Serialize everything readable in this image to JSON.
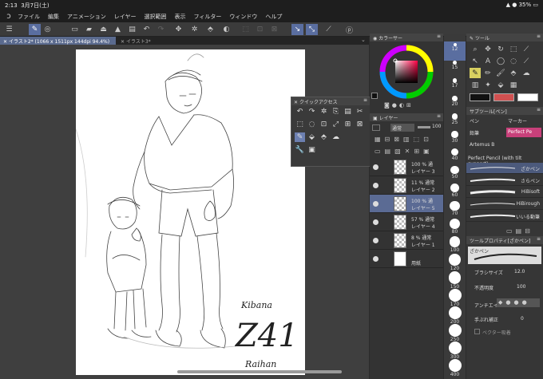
{
  "status": {
    "time": "2:13",
    "date": "3月7日(土)",
    "battery": "35%"
  },
  "menu": [
    "ファイル",
    "編集",
    "アニメーション",
    "レイヤー",
    "選択範囲",
    "表示",
    "フィルター",
    "ウィンドウ",
    "ヘルプ"
  ],
  "tabs": [
    {
      "label": "イラスト2* (1066 x 1511px 144dpi 94.4%)",
      "active": true
    },
    {
      "label": "イラスト3*",
      "active": false
    }
  ],
  "signature": {
    "line1": "Kibana",
    "line2": "Z41",
    "line3": "Raihan"
  },
  "color_panel": {
    "title": "カラーサー"
  },
  "layer_panel": {
    "title": "レイヤー",
    "blend": "通常",
    "opacity": "100"
  },
  "layers": [
    {
      "line1": "100 % 通",
      "line2": "レイヤー 3",
      "selected": false,
      "thumb": "chk"
    },
    {
      "line1": "11 % 通常",
      "line2": "レイヤー 2",
      "selected": false,
      "thumb": "chk"
    },
    {
      "line1": "100 % 通",
      "line2": "レイヤー 5",
      "selected": true,
      "thumb": "chk"
    },
    {
      "line1": "57 % 通常",
      "line2": "レイヤー 4",
      "selected": false,
      "thumb": "chk"
    },
    {
      "line1": "8 % 通常",
      "line2": "レイヤー 1",
      "selected": false,
      "thumb": "chk"
    },
    {
      "line1": "",
      "line2": "用紙",
      "selected": false,
      "thumb": "white"
    }
  ],
  "brush_sizes": [
    "12",
    "15",
    "17",
    "20",
    "25",
    "30",
    "40",
    "50",
    "60",
    "70",
    "80",
    "100",
    "120",
    "150",
    "170",
    "200",
    "250",
    "300",
    "400"
  ],
  "tool_panel": {
    "title": "ツール"
  },
  "subtool_panel": {
    "title": "サブツール[ペン]"
  },
  "subtool_tabs": [
    "ペン",
    "マーカー",
    "鉛筆",
    "Perfect Pe",
    "Artemus B"
  ],
  "subtool_current": "Perfect Pencil (with tilt support)",
  "brushes": [
    "ざかペン",
    "さらペン",
    "HiBisoft",
    "HiBirough",
    "いいる動筆"
  ],
  "property_panel": {
    "title": "ツールプロパティ[ざかペン]",
    "preset": "ざかペン"
  },
  "properties": {
    "size_label": "ブラシサイズ",
    "size_value": "12.0",
    "opacity_label": "不透明度",
    "opacity_value": "100",
    "aa_label": "アンチエイ",
    "correction_label": "手ぶれ補正",
    "correction_value": "0",
    "vector_label": "ベクター吸着"
  },
  "quick_access": {
    "title": "クイックアクセス"
  }
}
